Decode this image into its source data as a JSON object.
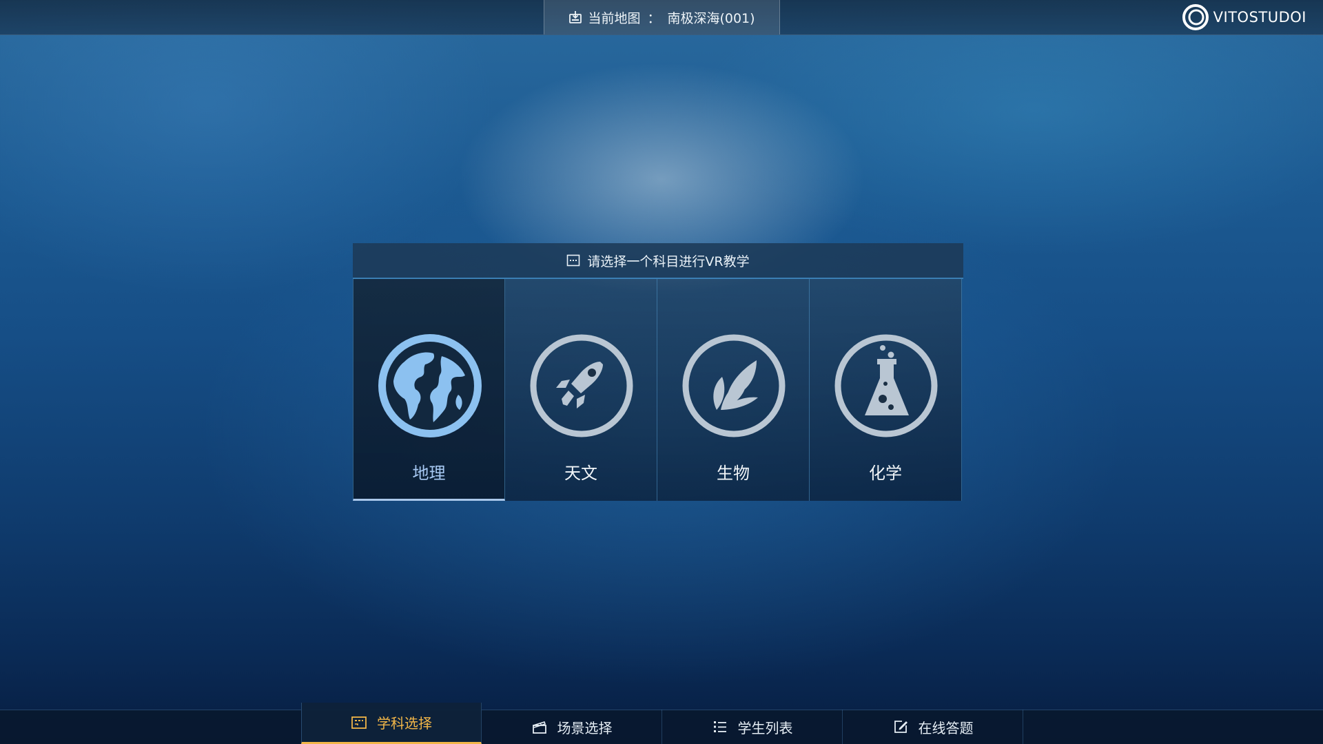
{
  "top_bar": {
    "map_label": "当前地图",
    "map_separator": "：",
    "map_value": "南极深海(001)",
    "brand": "VITOSTUDOI"
  },
  "panel": {
    "header": "请选择一个科目进行VR教学",
    "subjects": [
      {
        "label": "地理",
        "icon": "globe-icon",
        "selected": true
      },
      {
        "label": "天文",
        "icon": "rocket-icon",
        "selected": false
      },
      {
        "label": "生物",
        "icon": "leaf-icon",
        "selected": false
      },
      {
        "label": "化学",
        "icon": "flask-icon",
        "selected": false
      }
    ]
  },
  "bottom_nav": {
    "tabs": [
      {
        "label": "学科选择",
        "icon": "subject-select-icon",
        "active": true
      },
      {
        "label": "场景选择",
        "icon": "clapperboard-icon",
        "active": false
      },
      {
        "label": "学生列表",
        "icon": "list-icon",
        "active": false
      },
      {
        "label": "在线答题",
        "icon": "edit-icon",
        "active": false
      }
    ]
  },
  "colors": {
    "accent_active": "#f2b648",
    "selected_subject": "#a7c9f3",
    "icon_default": "#b9c6d3"
  }
}
